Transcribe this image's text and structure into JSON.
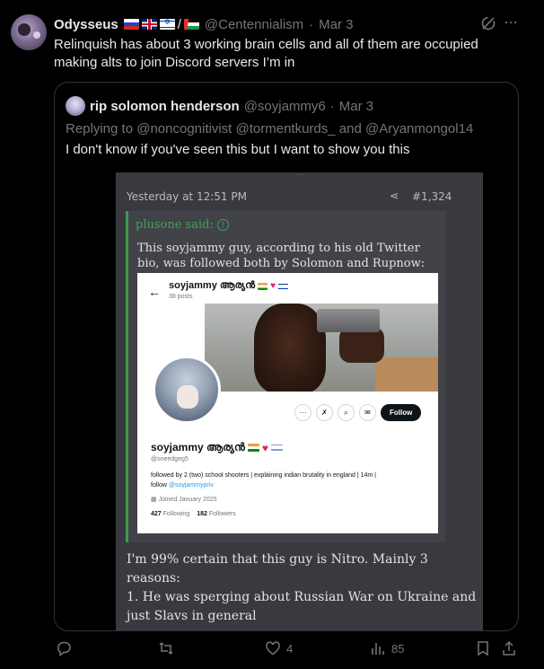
{
  "post": {
    "display_name": "Odysseus",
    "name_flags": [
      "flag-ru",
      "flag-uk",
      "flag-il",
      "flag-ps"
    ],
    "handle": "@Centennialism",
    "separator": "·",
    "date": "Mar 3",
    "text": "Relinquish has about 3 working brain cells and all of them are occupied making alts to join Discord servers I’m in"
  },
  "quote": {
    "display_name": "rip solomon henderson",
    "handle": "@soyjammy6",
    "separator": "·",
    "date": "Mar 3",
    "reply_prefix": "Replying to",
    "mentions": "@noncognitivist @tormentkurds_ and @Aryanmongol14",
    "text": "I don't know if you've seen this but I want to show you this"
  },
  "screenshot": {
    "timestamp": "Yesterday at 12:51 PM",
    "post_number": "#1,324",
    "quoted_user": "plusone said:",
    "quoted_text": "This soyjammy guy, according to his old Twitter bio, was followed both by Solomon and Rupnow:",
    "profile": {
      "name": "soyjammy ആര്യൻ",
      "posts": "38 posts",
      "handle": "@sneedgeg5",
      "bio": "followed by 2 (two) school shooters | explaining indian brutality in england | 14m |",
      "bio_link_prefix": "follow",
      "bio_link": "@soyjammypriv",
      "joined": "Joined January 2025",
      "following_count": "427",
      "following_label": "Following",
      "followers_count": "182",
      "followers_label": "Followers",
      "follow_button": "Follow"
    },
    "body_lines": [
      "I'm 99% certain that this guy is Nitro. Mainly 3 reasons:",
      "1. He was sperging about Russian War on Ukraine and just Slavs in general"
    ]
  },
  "actions": {
    "replies": "",
    "reposts": "",
    "likes": "4",
    "views": "85"
  }
}
